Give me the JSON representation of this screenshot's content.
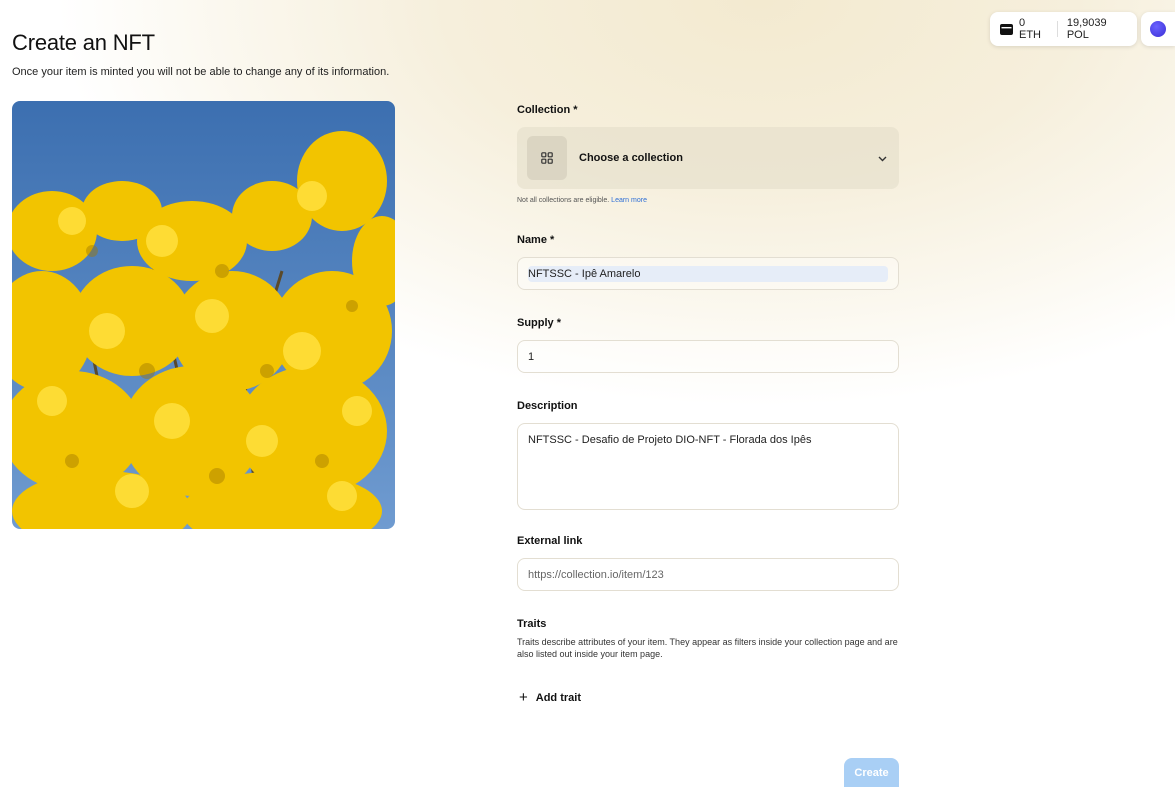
{
  "header": {
    "title": "Create an NFT",
    "subtitle": "Once your item is minted you will not be able to change any of its information."
  },
  "wallet": {
    "eth_balance": "0 ETH",
    "pol_balance": "19,9039 POL"
  },
  "form": {
    "collection": {
      "label": "Collection *",
      "placeholder": "Choose a collection",
      "hint": "Not all collections are eligible.",
      "hint_link": "Learn more"
    },
    "name": {
      "label": "Name *",
      "value": "NFTSSC - Ipê Amarelo"
    },
    "supply": {
      "label": "Supply *",
      "value": "1"
    },
    "description": {
      "label": "Description",
      "value": "NFTSSC - Desafio de Projeto DIO-NFT - Florada dos Ipês"
    },
    "external_link": {
      "label": "External link",
      "placeholder": "https://collection.io/item/123"
    },
    "traits": {
      "label": "Traits",
      "description": "Traits describe attributes of your item. They appear as filters inside your collection page and are also listed out inside your item page.",
      "add_label": "Add trait"
    },
    "create_label": "Create"
  },
  "colors": {
    "accent_disabled": "#a9cff5",
    "link": "#2f6fd6",
    "avatar": "#4a3fe6"
  }
}
